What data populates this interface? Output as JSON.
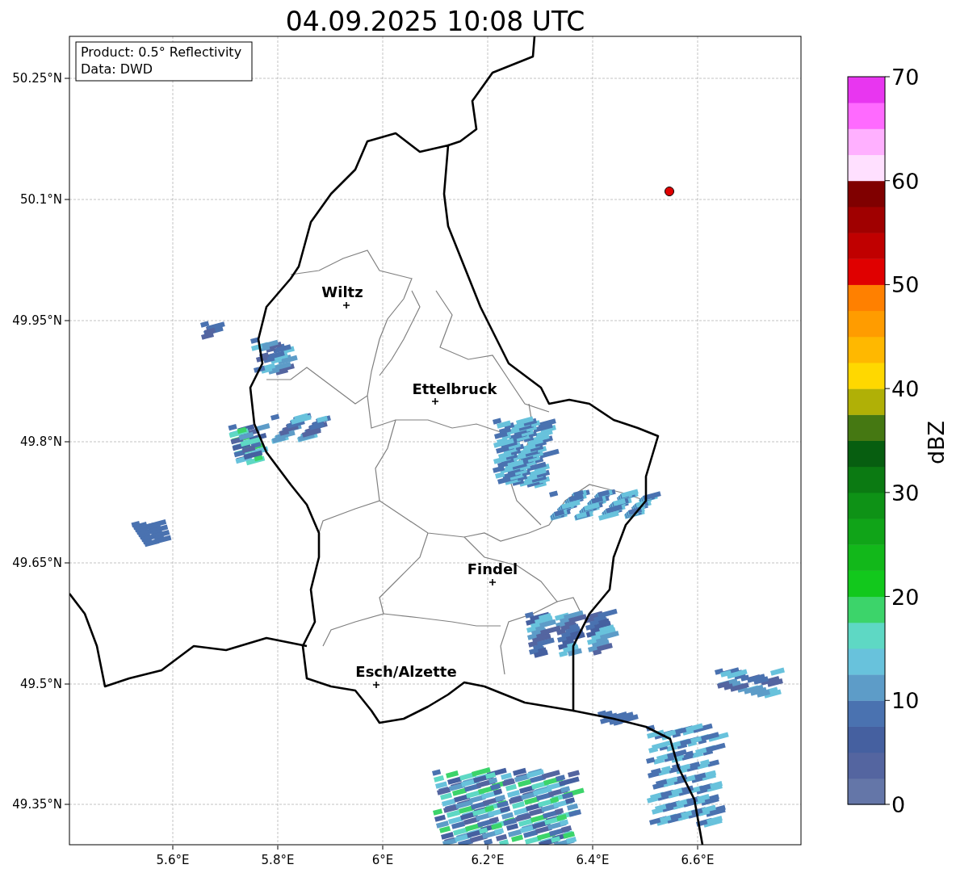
{
  "title": "04.09.2025 10:08 UTC",
  "legend": {
    "lines": [
      "Product: 0.5° Reflectivity",
      "Data: DWD"
    ]
  },
  "cities": [
    {
      "name": "Wiltz"
    },
    {
      "name": "Ettelbruck"
    },
    {
      "name": "Findel"
    },
    {
      "name": "Esch/Alzette"
    }
  ],
  "axes": {
    "y_ticks": [
      "50.25°N",
      "50.1°N",
      "49.95°N",
      "49.8°N",
      "49.65°N",
      "49.5°N",
      "49.35°N"
    ],
    "x_ticks": [
      "5.6°E",
      "5.8°E",
      "6°E",
      "6.2°E",
      "6.4°E",
      "6.6°E"
    ]
  },
  "colorbar": {
    "label": "dBZ",
    "ticks": [
      "70",
      "60",
      "50",
      "40",
      "30",
      "20",
      "10",
      "0"
    ],
    "steps": [
      {
        "color": "#6476a8"
      },
      {
        "color": "#5465a0"
      },
      {
        "color": "#4560a0"
      },
      {
        "color": "#4a72b0"
      },
      {
        "color": "#5d9cc8"
      },
      {
        "color": "#68c2dc"
      },
      {
        "color": "#5ed8c4"
      },
      {
        "color": "#3cd46a"
      },
      {
        "color": "#12c81c"
      },
      {
        "color": "#12b81a"
      },
      {
        "color": "#10a418"
      },
      {
        "color": "#0e9216"
      },
      {
        "color": "#0b7a12"
      },
      {
        "color": "#075e10"
      },
      {
        "color": "#457812"
      },
      {
        "color": "#b0b006"
      },
      {
        "color": "#ffd800"
      },
      {
        "color": "#ffb800"
      },
      {
        "color": "#ff9c00"
      },
      {
        "color": "#ff8000"
      },
      {
        "color": "#e00000"
      },
      {
        "color": "#c00000"
      },
      {
        "color": "#a00000"
      },
      {
        "color": "#800000"
      },
      {
        "color": "#ffe0ff"
      },
      {
        "color": "#ffb0ff"
      },
      {
        "color": "#ff6aff"
      },
      {
        "color": "#e836f0"
      }
    ]
  }
}
